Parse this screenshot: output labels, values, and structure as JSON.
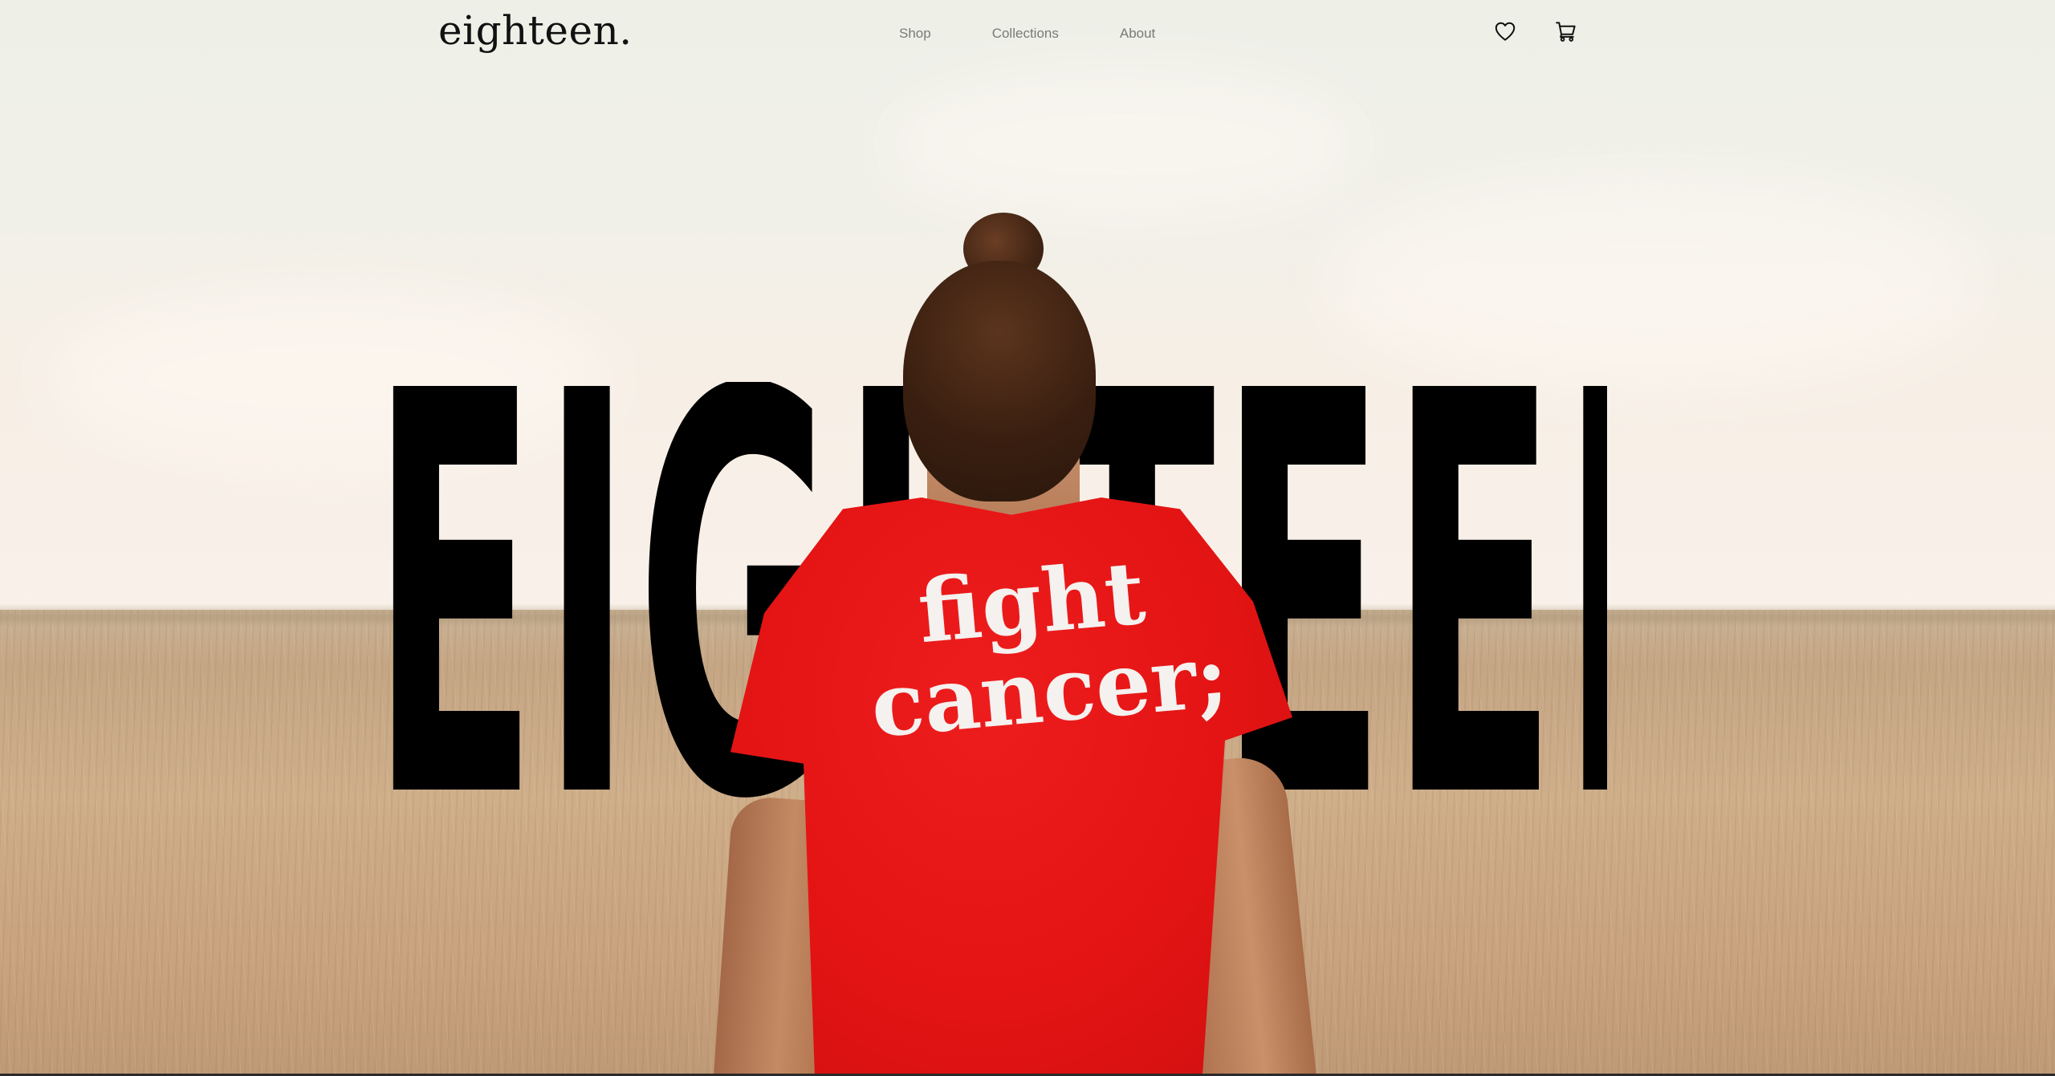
{
  "header": {
    "logo": "eighteen.",
    "nav": [
      {
        "label": "Shop"
      },
      {
        "label": "Collections"
      },
      {
        "label": "About"
      }
    ],
    "icons": [
      "heart-icon",
      "cart-icon"
    ]
  },
  "hero": {
    "headline": "EIGHTEEN",
    "shirt_text": "fight cancer;",
    "colors": {
      "headline": "#000000",
      "shirt": "#e41414",
      "shirt_text": "#f4f1ef"
    }
  }
}
